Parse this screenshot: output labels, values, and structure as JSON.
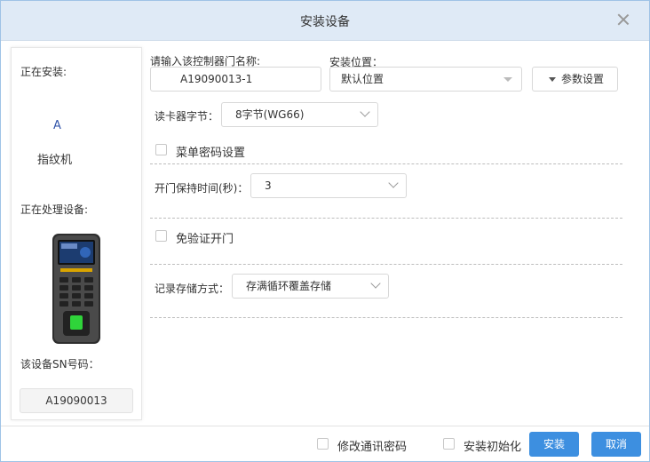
{
  "dialog": {
    "title": "安装设备"
  },
  "left_panel": {
    "installing_label": "正在安装:",
    "device_letter": "A",
    "device_type": "指纹机",
    "processing_label": "正在处理设备:",
    "sn_label": "该设备SN号码：",
    "sn_value": "A19090013"
  },
  "form": {
    "door_name_label": "请输入该控制器门名称:",
    "door_name_value": "A19090013-1",
    "location_label": "安装位置：",
    "location_value": "默认位置",
    "param_button": "参数设置",
    "reader_bytes_label": "读卡器字节：",
    "reader_bytes_value": "8字节(WG66)",
    "menu_password_label": "菜单密码设置",
    "door_hold_label": "开门保持时间(秒)：",
    "door_hold_value": "3",
    "no_auth_label": "免验证开门",
    "storage_label": "记录存储方式：",
    "storage_value": "存满循环覆盖存储"
  },
  "footer": {
    "modify_password_label": "修改通讯密码",
    "install_init_label": "安装初始化",
    "install_button": "安装",
    "cancel_button": "取消"
  },
  "colors": {
    "titlebar_bg": "#dfeaf6",
    "primary_button": "#3d8fe0"
  }
}
